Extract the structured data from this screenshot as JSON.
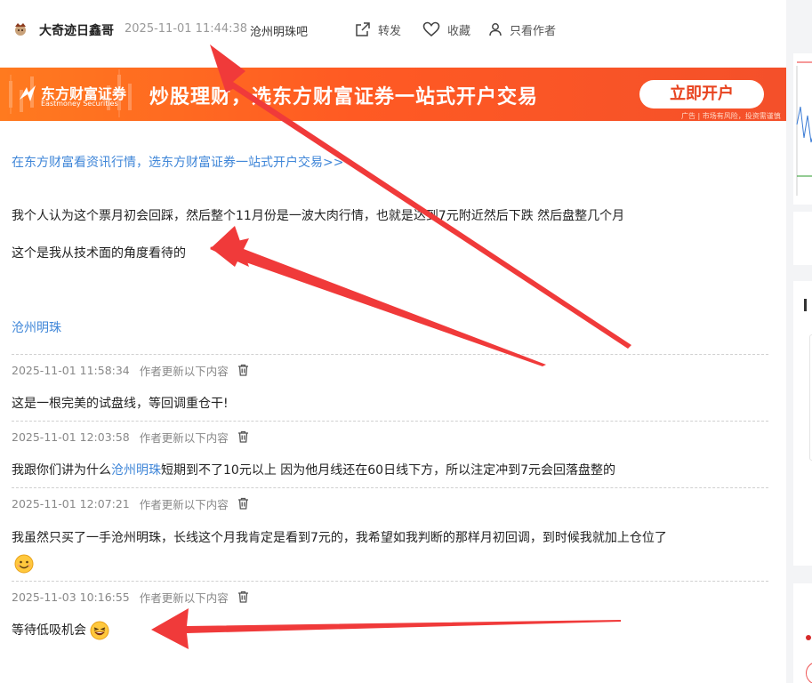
{
  "header": {
    "author": "大奇迹日鑫哥",
    "time": "2025-11-01 11:44:38",
    "bar_name": "沧州明珠吧",
    "share_label": "转发",
    "favorite_label": "收藏",
    "only_author_label": "只看作者"
  },
  "banner": {
    "logo_cn": "东方财富证券",
    "logo_en": "Eastmoney Securities",
    "slogan": "炒股理财，选东方财富证券一站式开户交易",
    "button_label": "立即开户",
    "note": "广告 | 市场有风险，投资需谨慎",
    "colors": {
      "gradient_start": "#ff7a1f",
      "gradient_end": "#f4502a",
      "button_text": "#e8431f"
    }
  },
  "post": {
    "promo_link": "在东方财富看资讯行情，选东方财富证券一站式开户交易>>",
    "line1": "我个人认为这个票月初会回踩，然后整个11月份是一波大肉行情，也就是达到7元附近然后下跌  然后盘整几个月",
    "line2": "这个是我从技术面的角度看待的",
    "bar_link": "沧州明珠"
  },
  "updates": [
    {
      "time": "2025-11-01 11:58:34",
      "label": "作者更新以下内容",
      "text": "这是一根完美的试盘线，等回调重仓干!"
    },
    {
      "time": "2025-11-01 12:03:58",
      "label": "作者更新以下内容",
      "text_before": "我跟你们讲为什么",
      "link": "沧州明珠",
      "text_after": "短期到不了10元以上 因为他月线还在60日线下方，所以注定冲到7元会回落盘整的"
    },
    {
      "time": "2025-11-01 12:07:21",
      "label": "作者更新以下内容",
      "text": "我虽然只买了一手沧州明珠，长线这个月我肯定是看到7元的，我希望如我判断的那样月初回调，到时候我就加上仓位了",
      "emoji": "smile-emoji"
    },
    {
      "time": "2025-11-03 10:16:55",
      "label": "作者更新以下内容",
      "text": "等待低吸机会",
      "emoji": "laugh-emoji"
    }
  ],
  "colors": {
    "link": "#3f86d8",
    "arrow": "#f03a3a",
    "meta": "#888888"
  }
}
